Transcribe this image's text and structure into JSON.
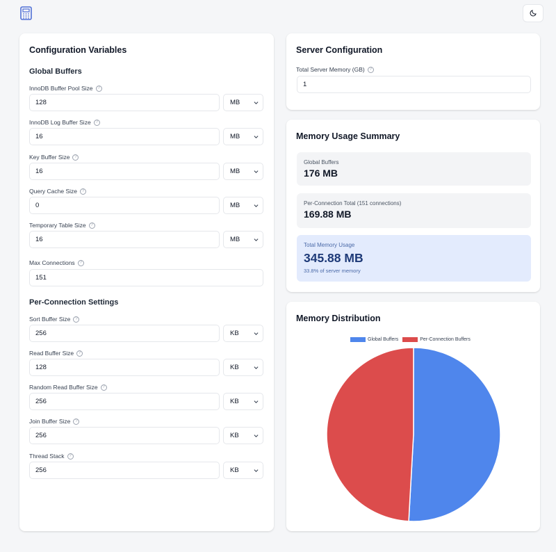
{
  "header": {
    "app_icon": "calculator-icon",
    "theme_icon": "moon-icon"
  },
  "config": {
    "title": "Configuration Variables",
    "global_title": "Global Buffers",
    "global_fields": [
      {
        "label": "InnoDB Buffer Pool Size",
        "value": "128",
        "unit": "MB"
      },
      {
        "label": "InnoDB Log Buffer Size",
        "value": "16",
        "unit": "MB"
      },
      {
        "label": "Key Buffer Size",
        "value": "16",
        "unit": "MB"
      },
      {
        "label": "Query Cache Size",
        "value": "0",
        "unit": "MB"
      },
      {
        "label": "Temporary Table Size",
        "value": "16",
        "unit": "MB"
      }
    ],
    "max_connections": {
      "label": "Max Connections",
      "value": "151"
    },
    "per_conn_title": "Per-Connection Settings",
    "per_conn_fields": [
      {
        "label": "Sort Buffer Size",
        "value": "256",
        "unit": "KB"
      },
      {
        "label": "Read Buffer Size",
        "value": "128",
        "unit": "KB"
      },
      {
        "label": "Random Read Buffer Size",
        "value": "256",
        "unit": "KB"
      },
      {
        "label": "Join Buffer Size",
        "value": "256",
        "unit": "KB"
      },
      {
        "label": "Thread Stack",
        "value": "256",
        "unit": "KB"
      }
    ]
  },
  "server": {
    "title": "Server Configuration",
    "memory_label": "Total Server Memory (GB)",
    "memory_value": "1"
  },
  "summary": {
    "title": "Memory Usage Summary",
    "global_label": "Global Buffers",
    "global_value": "176 MB",
    "per_conn_label": "Per-Connection Total (151 connections)",
    "per_conn_value": "169.88 MB",
    "total_label": "Total Memory Usage",
    "total_value": "345.88 MB",
    "total_note": "33.8% of server memory"
  },
  "distribution": {
    "title": "Memory Distribution"
  },
  "chart_data": {
    "type": "pie",
    "categories": [
      "Global Buffers",
      "Per-Connection Buffers"
    ],
    "values": [
      176,
      169.88
    ],
    "colors": [
      "#4f86ec",
      "#dc4c4c"
    ],
    "legend": "top"
  }
}
